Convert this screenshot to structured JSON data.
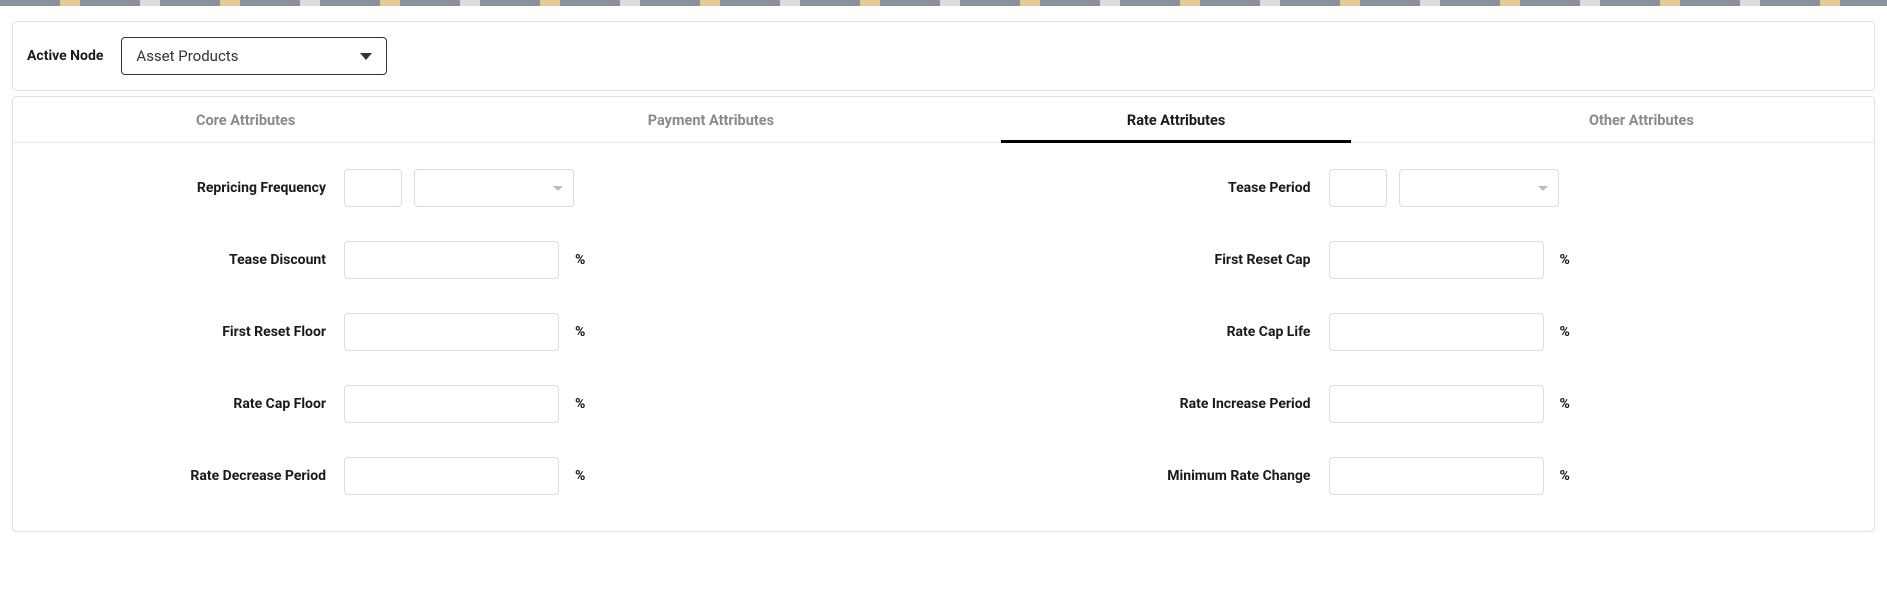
{
  "header": {
    "active_node_label": "Active Node",
    "active_node_value": "Asset Products"
  },
  "tabs": {
    "core": "Core Attributes",
    "payment": "Payment Attributes",
    "rate": "Rate Attributes",
    "other": "Other Attributes",
    "active": "rate"
  },
  "form": {
    "left": {
      "repricing_frequency": {
        "label": "Repricing Frequency",
        "value": "",
        "unit": ""
      },
      "tease_discount": {
        "label": "Tease Discount",
        "value": "",
        "suffix": "%"
      },
      "first_reset_floor": {
        "label": "First Reset Floor",
        "value": "",
        "suffix": "%"
      },
      "rate_cap_floor": {
        "label": "Rate Cap Floor",
        "value": "",
        "suffix": "%"
      },
      "rate_decrease_period": {
        "label": "Rate Decrease Period",
        "value": "",
        "suffix": "%"
      }
    },
    "right": {
      "tease_period": {
        "label": "Tease Period",
        "value": "",
        "unit": ""
      },
      "first_reset_cap": {
        "label": "First Reset Cap",
        "value": "",
        "suffix": "%"
      },
      "rate_cap_life": {
        "label": "Rate Cap Life",
        "value": "",
        "suffix": "%"
      },
      "rate_increase_period": {
        "label": "Rate Increase Period",
        "value": "",
        "suffix": "%"
      },
      "minimum_rate_change": {
        "label": "Minimum Rate Change",
        "value": "",
        "suffix": "%"
      }
    }
  }
}
